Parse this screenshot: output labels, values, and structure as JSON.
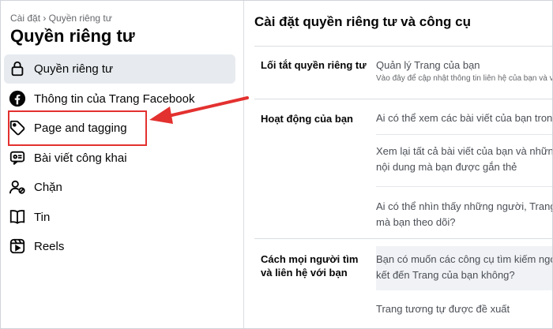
{
  "sidebar": {
    "breadcrumb": "Cài đặt › Quyền riêng tư",
    "title": "Quyền riêng tư",
    "items": [
      {
        "label": "Quyền riêng tư",
        "icon": "lock-icon",
        "active": true
      },
      {
        "label": "Thông tin của Trang Facebook",
        "icon": "facebook-icon",
        "active": false
      },
      {
        "label": "Page and tagging",
        "icon": "tag-icon",
        "active": false
      },
      {
        "label": "Bài viết công khai",
        "icon": "public-posts-icon",
        "active": false
      },
      {
        "label": "Chặn",
        "icon": "block-user-icon",
        "active": false
      },
      {
        "label": "Tin",
        "icon": "stories-icon",
        "active": false
      },
      {
        "label": "Reels",
        "icon": "reels-icon",
        "active": false
      }
    ]
  },
  "main": {
    "title": "Cài đặt quyền riêng tư và công cụ",
    "sections": [
      {
        "label": "Lối tắt quyền riêng tư",
        "rows": [
          {
            "text": "Quản lý Trang của bạn",
            "sub": "Vào đây để cập nhật thông tin liên hệ của bạn và v"
          }
        ]
      },
      {
        "label": "Hoạt động của bạn",
        "rows": [
          {
            "text": "Ai có thể xem các bài viết của bạn trong t"
          },
          {
            "text": "Xem lại tất cả bài viết của bạn và những",
            "text2": "nội dung mà bạn được gắn thẻ"
          },
          {
            "text": "Ai có thể nhìn thấy những người, Trang v",
            "text2": "mà bạn theo dõi?"
          }
        ]
      },
      {
        "label": "Cách mọi người tìm và liên hệ với bạn",
        "rows": [
          {
            "text": "Bạn có muốn các công cụ tìm kiếm ngoà",
            "text2": "kết đến Trang của bạn không?"
          },
          {
            "text": "Trang tương tự được đề xuất"
          }
        ]
      }
    ]
  },
  "annotation": {
    "highlight_color": "#e3312f"
  }
}
